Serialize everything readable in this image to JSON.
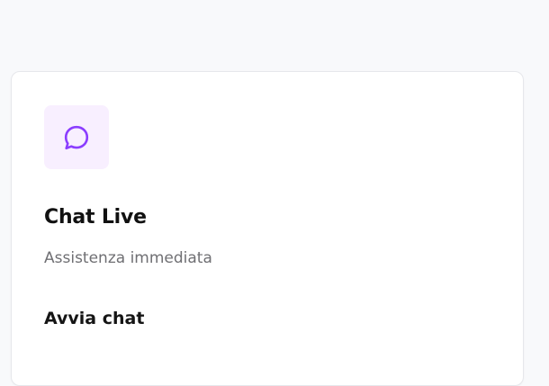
{
  "card": {
    "icon": "chat-bubble-icon",
    "accent_color": "#8b3dff",
    "icon_bg_color": "#f8efff",
    "title": "Chat Live",
    "subtitle": "Assistenza immediata",
    "action_label": "Avvia chat"
  }
}
